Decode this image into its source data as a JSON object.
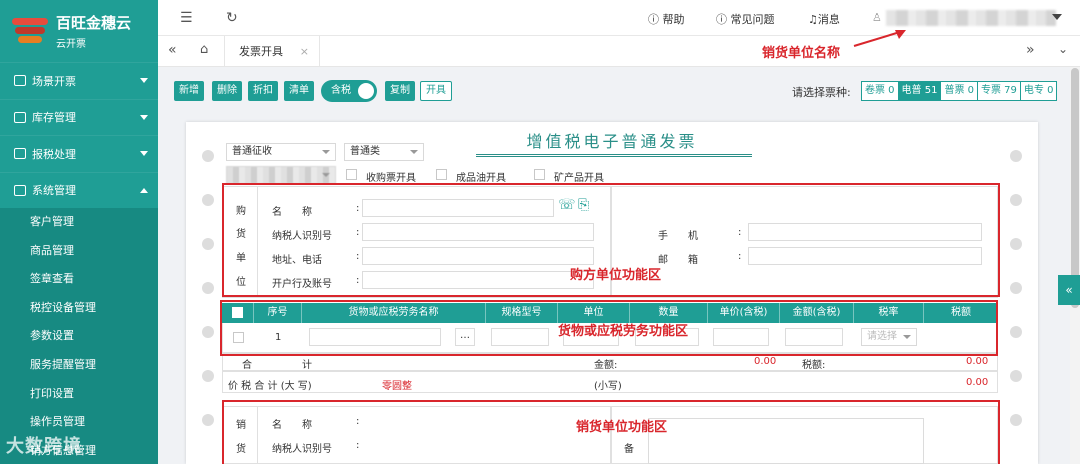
{
  "app": {
    "title": "百旺金穗云",
    "subtitle": "云开票",
    "watermark": "大数跨境"
  },
  "sidebar": {
    "groups": [
      {
        "label": "场景开票"
      },
      {
        "label": "库存管理"
      },
      {
        "label": "报税处理"
      },
      {
        "label": "系统管理"
      }
    ],
    "sub_items": [
      "客户管理",
      "商品管理",
      "签章查看",
      "税控设备管理",
      "参数设置",
      "服务提醒管理",
      "打印设置",
      "操作员管理",
      "销方信息管理"
    ]
  },
  "topbar": {
    "help": "帮助",
    "faq": "常见问题",
    "messages": "消息"
  },
  "tabs": [
    {
      "label": "发票开具"
    }
  ],
  "toolbar": {
    "buttons": [
      "新增",
      "删除",
      "折扣",
      "清单"
    ],
    "toggle_label": "含税",
    "copy": "复制",
    "issue": "开具",
    "ticket_label": "请选择票种:",
    "tickets": [
      "卷票 0",
      "电普 51",
      "普票 0",
      "专票 79",
      "电专 0"
    ]
  },
  "invoice": {
    "title": "增值税电子普通发票",
    "levy_type": "普通征收",
    "category": "普通类",
    "options": [
      "收购票开具",
      "成品油开具",
      "矿产品开具"
    ],
    "buyer": {
      "side": [
        "购",
        "货",
        "单",
        "位"
      ],
      "name_label": "名　　称",
      "tax_id_label": "纳税人识别号",
      "address_label": "地址、电话",
      "bank_label": "开户行及账号",
      "phone_label": "手　　机",
      "email_label": "邮　　箱"
    },
    "goods": {
      "headers": [
        "序号",
        "货物或应税劳务名称",
        "规格型号",
        "单位",
        "数量",
        "单价(含税)",
        "金额(含税)",
        "税率",
        "税额"
      ],
      "row_no": "1",
      "rate_placeholder": "请选择",
      "more": "…"
    },
    "totals": {
      "heji": "合　　　　　计",
      "amount_label": "金额:",
      "amount": "0.00",
      "tax_label": "税额:",
      "tax": "0.00",
      "total_label": "价 税 合 计 (大 写)",
      "total_upper": "零圆整",
      "small_label": "(小写)",
      "small": "0.00"
    },
    "seller": {
      "side": [
        "销",
        "货"
      ],
      "name_label": "名　　称",
      "tax_id_label": "纳税人识别号",
      "remark": "备"
    }
  },
  "annotations": {
    "seller_name": "销货单位名称",
    "buyer_area": "购方单位功能区",
    "goods_area": "货物或应税劳务功能区",
    "seller_area": "销货单位功能区"
  },
  "colors": {
    "primary": "#1f9e95",
    "annotation": "#d9262c"
  }
}
